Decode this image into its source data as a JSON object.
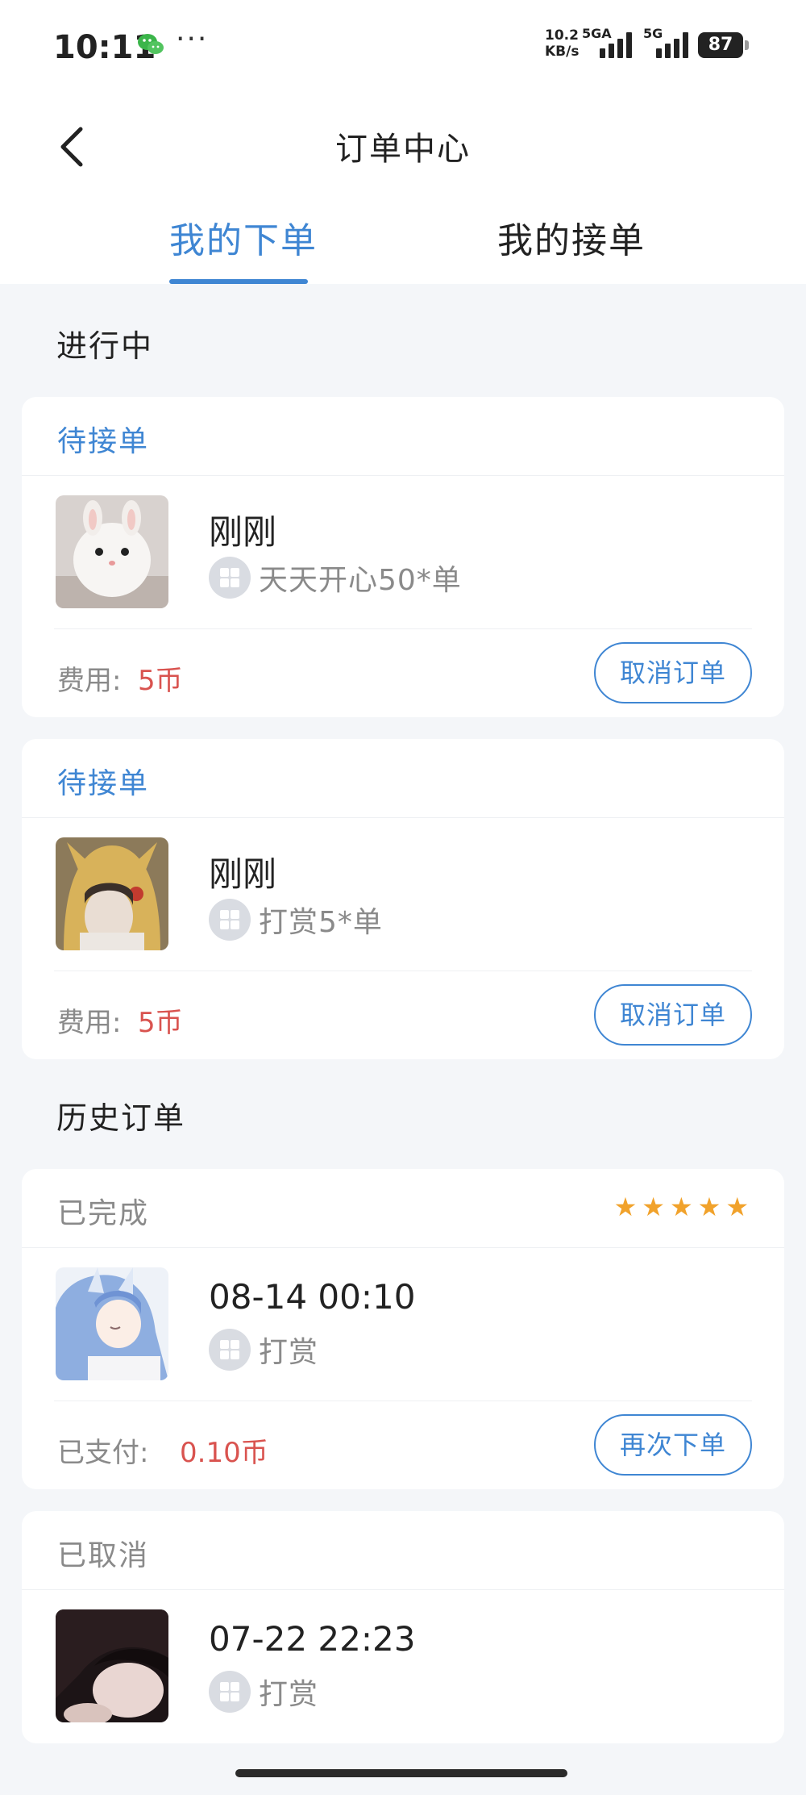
{
  "status_bar": {
    "time": "10:11",
    "more": "···",
    "net_rate_value": "10.2",
    "net_rate_unit": "KB/s",
    "sim1_label": "5GA",
    "sim2_label": "5G",
    "battery": "87"
  },
  "header": {
    "title": "订单中心"
  },
  "tabs": [
    {
      "label": "我的下单",
      "active": true
    },
    {
      "label": "我的接单",
      "active": false
    }
  ],
  "sections": {
    "in_progress": "进行中",
    "history": "历史订单"
  },
  "in_progress_orders": [
    {
      "status": "待接单",
      "time": "刚刚",
      "service": "天天开心50*单",
      "fee_label": "费用:",
      "fee_value": "5币",
      "action": "取消订单",
      "thumb": "white-rabbit-image"
    },
    {
      "status": "待接单",
      "time": "刚刚",
      "service": "打赏5*单",
      "fee_label": "费用:",
      "fee_value": "5币",
      "action": "取消订单",
      "thumb": "pikachu-hood-portrait-image"
    }
  ],
  "history_orders": [
    {
      "status": "已完成",
      "rating": 5,
      "time": "08-14 00:10",
      "service": "打赏",
      "fee_label": "已支付:",
      "fee_value": "0.10币",
      "action": "再次下单",
      "thumb": "anime-blue-hair-girl-image"
    },
    {
      "status": "已取消",
      "time": "07-22 22:23",
      "service": "打赏",
      "thumb": "dark-portrait-image"
    }
  ],
  "colors": {
    "accent": "#3f86d3",
    "price": "#d9534f",
    "star": "#f1a22b",
    "page_bg": "#f4f6f9",
    "card_bg": "#ffffff"
  }
}
